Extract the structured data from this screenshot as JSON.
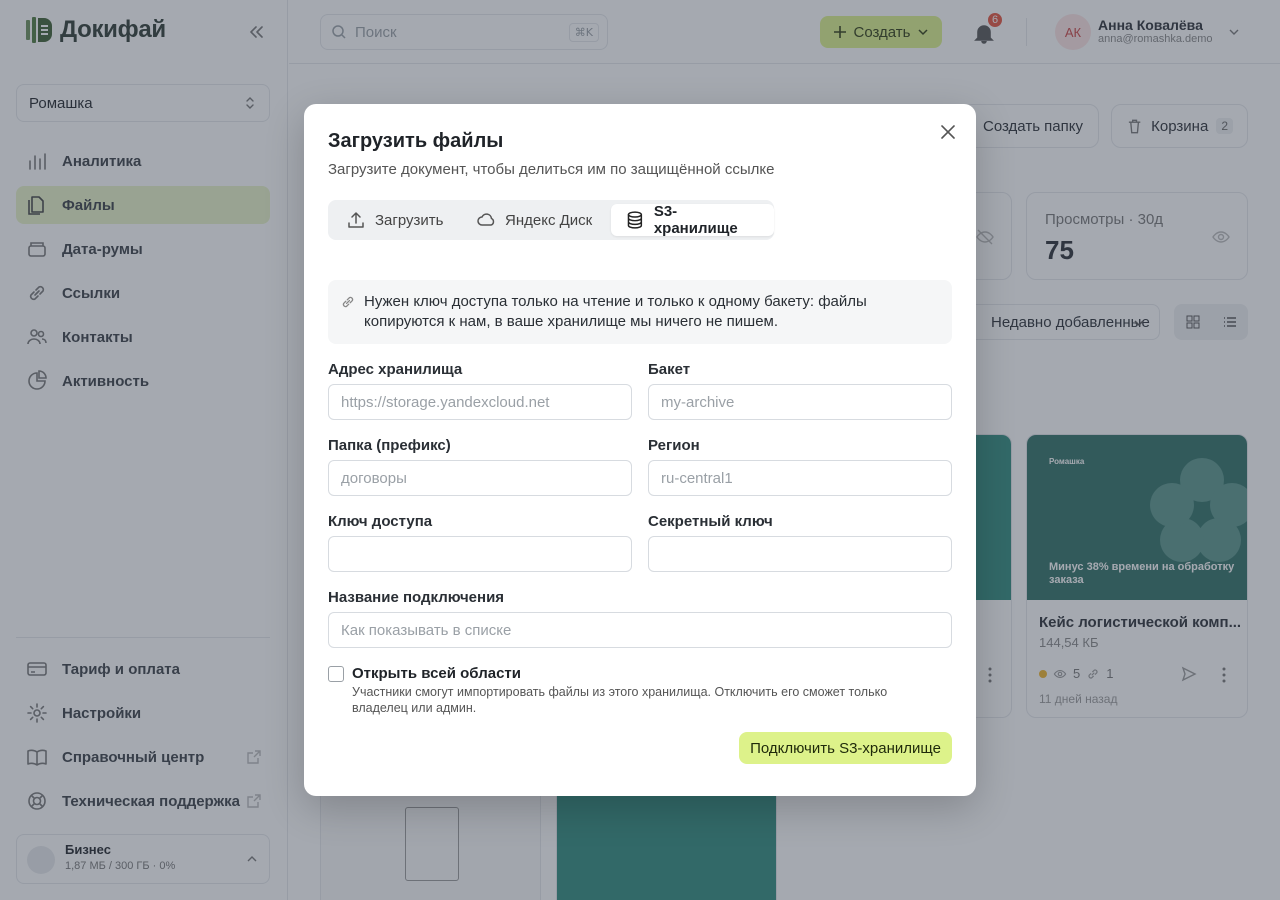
{
  "app": {
    "logo": "Докифай"
  },
  "sidebar": {
    "workspace": "Ромашка",
    "items": [
      {
        "label": "Аналитика",
        "icon": "chart-icon"
      },
      {
        "label": "Файлы",
        "icon": "files-icon",
        "active": true
      },
      {
        "label": "Дата-румы",
        "icon": "box-icon"
      },
      {
        "label": "Ссылки",
        "icon": "link-icon"
      },
      {
        "label": "Контакты",
        "icon": "users-icon"
      },
      {
        "label": "Активность",
        "icon": "activity-icon"
      }
    ],
    "bottom_items": [
      {
        "label": "Тариф и оплата",
        "icon": "card-icon"
      },
      {
        "label": "Настройки",
        "icon": "gear-icon"
      },
      {
        "label": "Справочный центр",
        "icon": "book-icon",
        "external": true
      },
      {
        "label": "Техническая поддержка",
        "icon": "support-icon",
        "external": true
      }
    ],
    "plan": {
      "name": "Бизнес",
      "usage": "1,87 МБ / 300 ГБ · 0%"
    }
  },
  "topbar": {
    "search_placeholder": "Поиск",
    "search_shortcut": "⌘K",
    "create_label": "Создать",
    "notifications": "6",
    "user": {
      "initials": "АК",
      "name": "Анна Ковалёва",
      "email": "anna@romashka.demo"
    }
  },
  "page": {
    "create_folder": "Создать папку",
    "trash": "Корзина",
    "trash_count": "2",
    "stat_views_label": "Просмотры · 30д",
    "stat_views_value": "75",
    "sort_label": "Недавно добавленные",
    "cards": [
      {
        "title": "Кейс логистической комп...",
        "size": "144,54 КБ",
        "views": "5",
        "links": "1",
        "age": "11 дней назад",
        "thumb_brand": "Ромашка",
        "thumb_headline": "Минус 38% времени на обработку заказа"
      }
    ]
  },
  "modal": {
    "title": "Загрузить файлы",
    "subtitle": "Загрузите документ, чтобы делиться им по защищённой ссылке",
    "tabs": [
      {
        "label": "Загрузить",
        "icon": "upload-icon"
      },
      {
        "label": "Яндекс Диск",
        "icon": "cloud-icon"
      },
      {
        "label": "S3-хранилище",
        "icon": "database-icon",
        "active": true
      }
    ],
    "info": "Нужен ключ доступа только на чтение и только к одному бакету: файлы копируются к нам, в ваше хранилище мы ничего не пишем.",
    "fields": {
      "endpoint": {
        "label": "Адрес хранилища",
        "placeholder": "https://storage.yandexcloud.net",
        "value": ""
      },
      "bucket": {
        "label": "Бакет",
        "placeholder": "my-archive",
        "value": ""
      },
      "prefix": {
        "label": "Папка (префикс)",
        "placeholder": "договоры",
        "value": ""
      },
      "region": {
        "label": "Регион",
        "placeholder": "ru-central1",
        "value": ""
      },
      "access_key": {
        "label": "Ключ доступа",
        "placeholder": "",
        "value": ""
      },
      "secret_key": {
        "label": "Секретный ключ",
        "placeholder": "",
        "value": ""
      },
      "name": {
        "label": "Название подключения",
        "placeholder": "Как показывать в списке",
        "value": ""
      }
    },
    "share": {
      "label": "Открыть всей области",
      "description": "Участники смогут импортировать файлы из этого хранилища. Отключить его сможет только владелец или админ.",
      "checked": false
    },
    "submit": "Подключить S3-хранилище"
  }
}
